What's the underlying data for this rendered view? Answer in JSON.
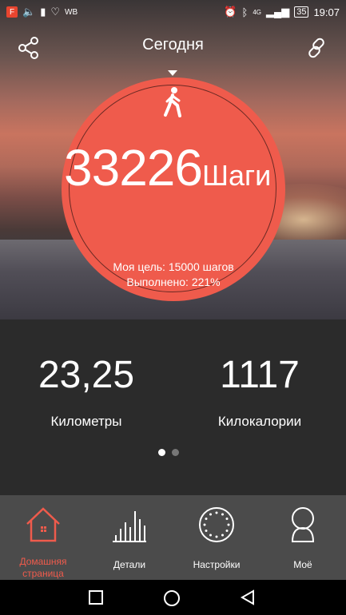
{
  "status_bar": {
    "app_badge": "F",
    "carrier_text": "WB",
    "network": "4G",
    "battery": "35",
    "time": "19:07"
  },
  "header": {
    "title": "Сегодня",
    "share_icon": "share-icon",
    "link_icon": "link-icon"
  },
  "steps": {
    "count": "33226",
    "unit": "Шаги",
    "goal_text": "Моя цель: 15000 шагов",
    "completed_text": "Выполнено: 221%",
    "completed_percent": 221
  },
  "metrics": [
    {
      "value": "23,25",
      "label": "Километры"
    },
    {
      "value": "1117",
      "label": "Килокалории"
    }
  ],
  "pager": {
    "count": 2,
    "active": 0
  },
  "tabs": [
    {
      "label": "Домашняя страница",
      "icon": "home-icon",
      "active": true
    },
    {
      "label": "Детали",
      "icon": "bar-chart-icon",
      "active": false
    },
    {
      "label": "Настройки",
      "icon": "settings-dial-icon",
      "active": false
    },
    {
      "label": "Моё",
      "icon": "user-icon",
      "active": false
    }
  ],
  "colors": {
    "accent": "#ef5b4c",
    "tabbar": "#4b4b4b",
    "panel": "#2b2b2b"
  }
}
